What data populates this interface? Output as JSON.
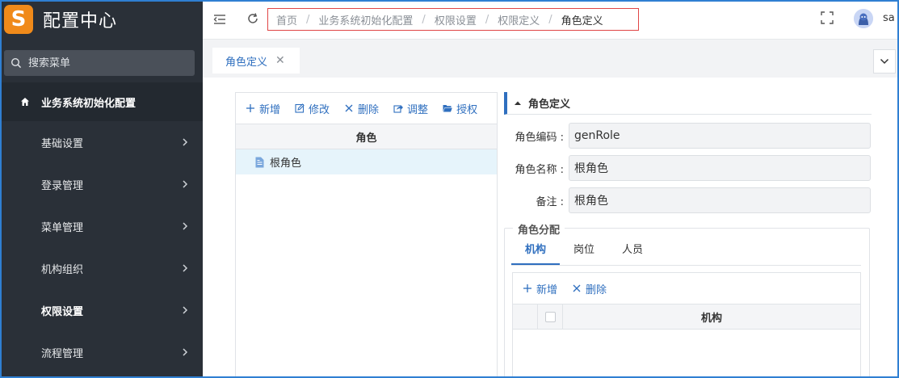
{
  "app": {
    "logo_letter": "S",
    "title": "配置中心"
  },
  "search": {
    "placeholder": "搜索菜单"
  },
  "sidebar": {
    "group_label": "业务系统初始化配置",
    "items": [
      {
        "label": "基础设置"
      },
      {
        "label": "登录管理"
      },
      {
        "label": "菜单管理"
      },
      {
        "label": "机构组织"
      },
      {
        "label": "权限设置"
      },
      {
        "label": "流程管理"
      }
    ]
  },
  "breadcrumb": [
    "首页",
    "业务系统初始化配置",
    "权限设置",
    "权限定义",
    "角色定义"
  ],
  "breadcrumb_sep": "/",
  "user": {
    "name": "sa"
  },
  "tabs": [
    {
      "label": "角色定义",
      "close": "✕"
    }
  ],
  "left_panel": {
    "toolbar": [
      {
        "label": "新增",
        "icon": "plus-icon"
      },
      {
        "label": "修改",
        "icon": "edit-icon"
      },
      {
        "label": "删除",
        "icon": "close-icon"
      },
      {
        "label": "调整",
        "icon": "share-icon"
      },
      {
        "label": "授权",
        "icon": "folder-open-icon"
      }
    ],
    "column_header": "角色",
    "rows": [
      {
        "label": "根角色",
        "icon": "file-icon"
      }
    ]
  },
  "detail": {
    "section_title": "角色定义",
    "fields": [
      {
        "label": "角色编码 :",
        "value": "genRole"
      },
      {
        "label": "角色名称 :",
        "value": "根角色"
      },
      {
        "label": "备注 :",
        "value": "根角色"
      }
    ]
  },
  "assignment": {
    "legend": "角色分配",
    "tabs": [
      {
        "label": "机构"
      },
      {
        "label": "岗位"
      },
      {
        "label": "人员"
      }
    ],
    "active_tab": "机构",
    "toolbar": [
      {
        "label": "新增",
        "icon": "plus-icon"
      },
      {
        "label": "删除",
        "icon": "close-icon"
      }
    ],
    "column_header": "机构"
  },
  "colors": {
    "accent": "#2f6fbf",
    "sidebar_bg": "#2a3038",
    "logo": "#f08a1a",
    "highlight_border": "#e04545"
  }
}
